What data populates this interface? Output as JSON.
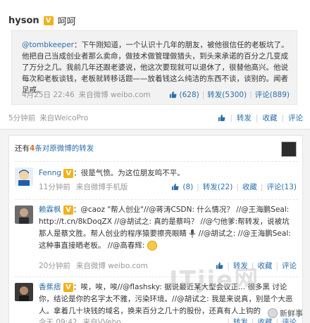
{
  "post": {
    "author": "hyson",
    "verified_badge": "V",
    "text": "呵呵",
    "quote": {
      "mention": "@tombkeeper",
      "body": "：下午刚知道，一个认识十几年的朋友，被他很信任的老板坑了。他把自己当成创业者那么卖命，做技术做管理做猎头，到头来承诺的百分之几变成了万分之几。我前几年还跟老婆说，他这次要现就可以退休了，很替他高兴。他说每次和老板谈钱，老板就转移话题——放着钱这么纯洁的东西不谈，谈别的。闻者足戒。",
      "time": "4月25日 22:46",
      "source": "来自微博 weibo.com",
      "like_count": "(628)",
      "repost_label": "转发(5300)",
      "comment_label": "评论(889)"
    },
    "time": "5分钟前",
    "source": "来自WeicoPro",
    "repost_label": "转发",
    "favorite_label": "收藏",
    "comment_label": "评论"
  },
  "reposts": {
    "prefix": "还有",
    "count": "4",
    "suffix": "条对原微博的转发",
    "items": [
      {
        "name": "Fenng",
        "badge": "V",
        "text": "：很是气愤。为这位朋友鸣不平。",
        "time": "11分钟前",
        "source": "来自微博手机版",
        "like_count": "(8)",
        "repost_label": "转发(22)",
        "favorite_label": "收藏",
        "comment_label": "评论(13)"
      },
      {
        "name": "赖霖枫",
        "badge": "V",
        "text": "：@caoz \"帮人创业\"//@蒋涛CSDN: 什么情况？ //@王海鹏Seal: http://t.cn/8kDoqZX //@胡试之: 真的是蔡吗？ //@勺他爹:帮转发，说被坑那人是蔡文胜。帮人创业的程序猿要擦亮眼睛",
        "text_tail": "//@胡试之: //@王海鹏Seal:这种事直接晒老板。 //@高春辉:",
        "time": "20分钟前",
        "source": "来自微博 weibo.com",
        "repost_label": "转发",
        "favorite_label": "收藏",
        "comment_label": "评论"
      },
      {
        "name": "香蕉痞",
        "badge": "V",
        "text": "：唉，唉，唉//@flashsky: 据说最近某大型会议正... 很多黑 讨论你，结论是你的名字太不雅，污染环境。//@胡试之: 我是来说真，别是个大恶人。拿着几十块钱的域名，换来百分之几十的股份，还真有人上钩的",
        "time": "今天 09:42",
        "source": "来自VVebo",
        "repost_label": "转发",
        "favorite_label": "收藏",
        "comment_label": "评论"
      }
    ]
  },
  "watermark": {
    "site": "ITjie网",
    "credit": "新鲜事"
  },
  "colors": {
    "link": "#2c6da8",
    "accent": "#e06a1a",
    "badge": "#f3b11a",
    "muted": "#999999"
  },
  "icons": [
    "thumbs-up-icon",
    "verified-badge-icon",
    "smiley-icon",
    "microphone-icon",
    "weibo-logo-icon"
  ]
}
